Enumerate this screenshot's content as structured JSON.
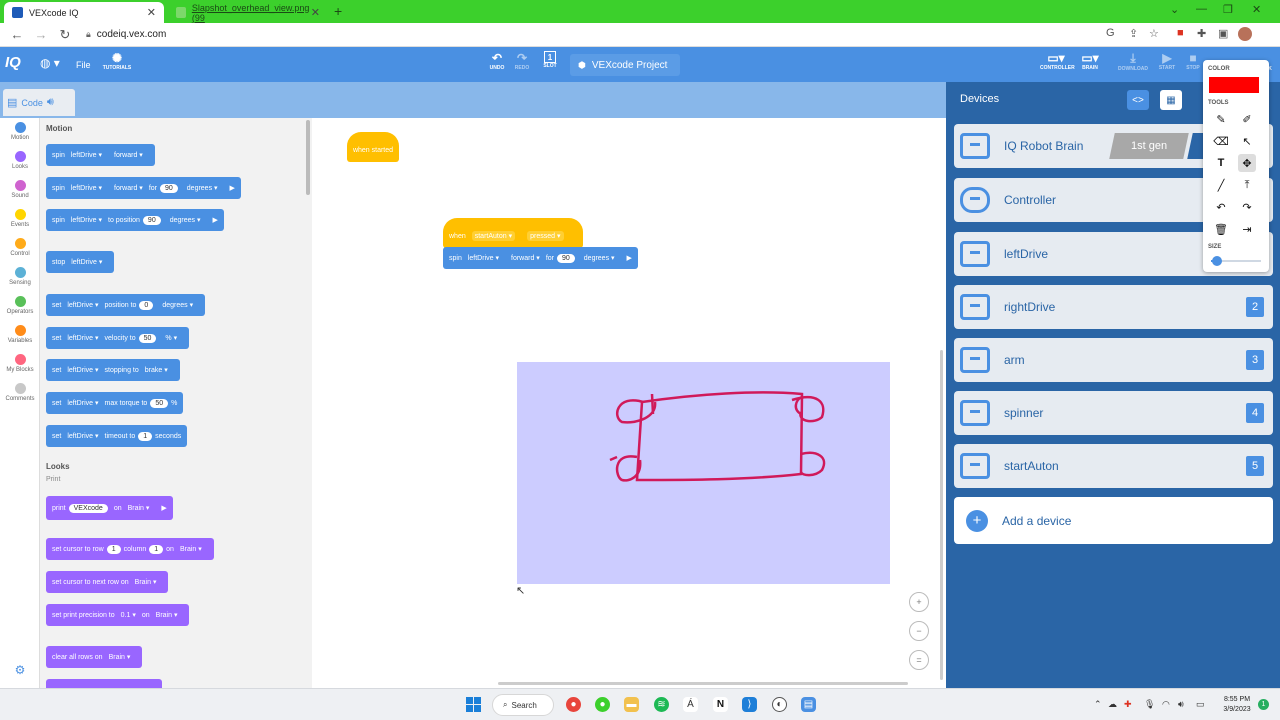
{
  "browser": {
    "tabs": [
      {
        "title": "VEXcode IQ",
        "active": true
      },
      {
        "title": "Slapshot_overhead_view.png (99",
        "active": false
      }
    ],
    "new_tab": "+",
    "url": "codeiq.vex.com",
    "window_controls": [
      "⌄",
      "—",
      "❐",
      "✕"
    ]
  },
  "app": {
    "logo": "IQ",
    "file_label": "File",
    "tutorials_label": "TUTORIALS",
    "undo_label": "UNDO",
    "redo_label": "REDO",
    "slot_label": "SLOT",
    "slot_value": "1",
    "project_name": "VEXcode Project",
    "controller_label": "CONTROLLER",
    "brain_label": "BRAIN",
    "download_label": "DOWNLOAD",
    "start_label": "START",
    "stop_label": "STOP",
    "share_label": "K",
    "accent_color": "#4a90e2"
  },
  "code_tab": {
    "label": "Code"
  },
  "categories": [
    {
      "label": "Motion",
      "color": "#4a90e2"
    },
    {
      "label": "Looks",
      "color": "#9966ff"
    },
    {
      "label": "Sound",
      "color": "#cf63cf"
    },
    {
      "label": "Events",
      "color": "#ffd500"
    },
    {
      "label": "Control",
      "color": "#ffab19"
    },
    {
      "label": "Sensing",
      "color": "#5cb1d6"
    },
    {
      "label": "Operators",
      "color": "#59c059"
    },
    {
      "label": "Variables",
      "color": "#ff8c1a"
    },
    {
      "label": "My Blocks",
      "color": "#ff6680"
    },
    {
      "label": "Comments",
      "color": "#c8c8c8"
    }
  ],
  "palette": {
    "motion_title": "Motion",
    "looks_title": "Looks",
    "print_sub": "Print",
    "blocks": {
      "b1": {
        "w1": "spin",
        "d1": "leftDrive",
        "d2": "forward"
      },
      "b2": {
        "w1": "spin",
        "d1": "leftDrive",
        "d2": "forward",
        "w2": "for",
        "p1": "90",
        "d3": "degrees"
      },
      "b3": {
        "w1": "spin",
        "d1": "leftDrive",
        "w2": "to position",
        "p1": "90",
        "d3": "degrees"
      },
      "b4": {
        "w1": "stop",
        "d1": "leftDrive"
      },
      "b5": {
        "w1": "set",
        "d1": "leftDrive",
        "w2": "position to",
        "p1": "0",
        "d3": "degrees"
      },
      "b6": {
        "w1": "set",
        "d1": "leftDrive",
        "w2": "velocity to",
        "p1": "50",
        "d3": "%"
      },
      "b7": {
        "w1": "set",
        "d1": "leftDrive",
        "w2": "stopping to",
        "d3": "brake"
      },
      "b8": {
        "w1": "set",
        "d1": "leftDrive",
        "w2": "max torque to",
        "p1": "50",
        "w3": "%"
      },
      "b9": {
        "w1": "set",
        "d1": "leftDrive",
        "w2": "timeout to",
        "p1": "1",
        "w3": "seconds"
      },
      "l1": {
        "w1": "print",
        "p1": "VEXcode",
        "w2": "on",
        "d1": "Brain"
      },
      "l2": {
        "w1": "set cursor to row",
        "p1": "1",
        "w2": "column",
        "p2": "1",
        "w3": "on",
        "d1": "Brain"
      },
      "l3": {
        "w1": "set cursor to next row on",
        "d1": "Brain"
      },
      "l4": {
        "w1": "set print precision to",
        "d1": "0.1",
        "w2": "on",
        "d2": "Brain"
      },
      "l5": {
        "w1": "clear all rows on",
        "d1": "Brain"
      }
    }
  },
  "workspace": {
    "hat1": "when started",
    "hat2": {
      "w1": "when",
      "d1": "startAuton",
      "d2": "pressed"
    },
    "spin": {
      "w1": "spin",
      "d1": "leftDrive",
      "d2": "forward",
      "w2": "for",
      "p1": "90",
      "d3": "degrees"
    },
    "zoom_in": "+",
    "zoom_out": "−",
    "zoom_reset": "="
  },
  "devices": {
    "title": "Devices",
    "gen_label": "1st gen",
    "items": [
      {
        "name": "IQ Robot Brain",
        "port": ""
      },
      {
        "name": "Controller",
        "port": ""
      },
      {
        "name": "leftDrive",
        "port": ""
      },
      {
        "name": "rightDrive",
        "port": "2"
      },
      {
        "name": "arm",
        "port": "3"
      },
      {
        "name": "spinner",
        "port": "4"
      },
      {
        "name": "startAuton",
        "port": "5"
      }
    ],
    "add_label": "Add a device"
  },
  "annotation_tool": {
    "color_label": "COLOR",
    "tools_label": "TOOLS",
    "size_label": "SIZE",
    "current_color": "#ff0000",
    "size_level": 0.12
  },
  "taskbar": {
    "search_label": "Search",
    "time": "8:55 PM",
    "date": "3/9/2023",
    "notifications": "1"
  }
}
